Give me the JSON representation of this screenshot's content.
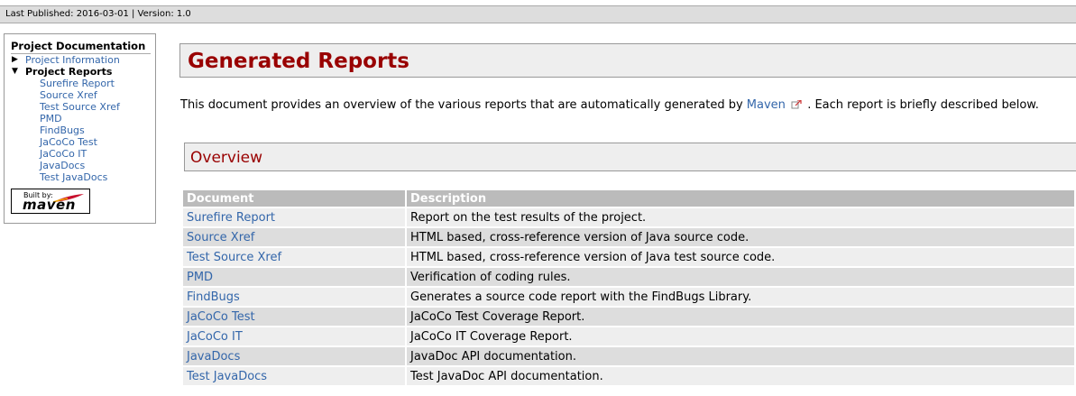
{
  "banner": {
    "text": "Last Published: 2016-03-01  | Version: 1.0"
  },
  "nav": {
    "section_title": "Project Documentation",
    "project_information": "Project Information",
    "project_reports": "Project Reports",
    "items": [
      "Surefire Report",
      "Source Xref",
      "Test Source Xref",
      "PMD",
      "FindBugs",
      "JaCoCo Test",
      "JaCoCo IT",
      "JavaDocs",
      "Test JavaDocs"
    ],
    "built_by_text": "Built by:",
    "built_by_logo": "maven"
  },
  "main": {
    "title": "Generated Reports",
    "intro_before": "This document provides an overview of the various reports that are automatically generated by ",
    "intro_link": "Maven",
    "intro_after": " . Each report is briefly described below.",
    "overview_title": "Overview",
    "table": {
      "headers": [
        "Document",
        "Description"
      ],
      "rows": [
        {
          "document": "Surefire Report",
          "description": "Report on the test results of the project."
        },
        {
          "document": "Source Xref",
          "description": "HTML based, cross-reference version of Java source code."
        },
        {
          "document": "Test Source Xref",
          "description": "HTML based, cross-reference version of Java test source code."
        },
        {
          "document": "PMD",
          "description": "Verification of coding rules."
        },
        {
          "document": "FindBugs",
          "description": "Generates a source code report with the FindBugs Library."
        },
        {
          "document": "JaCoCo Test",
          "description": "JaCoCo Test Coverage Report."
        },
        {
          "document": "JaCoCo IT",
          "description": "JaCoCo IT Coverage Report."
        },
        {
          "document": "JavaDocs",
          "description": "JavaDoc API documentation."
        },
        {
          "document": "Test JavaDocs",
          "description": "Test JavaDoc API documentation."
        }
      ]
    }
  },
  "colors": {
    "heading": "#990000",
    "link": "#3366aa",
    "table_header_bg": "#bbbbbb"
  }
}
